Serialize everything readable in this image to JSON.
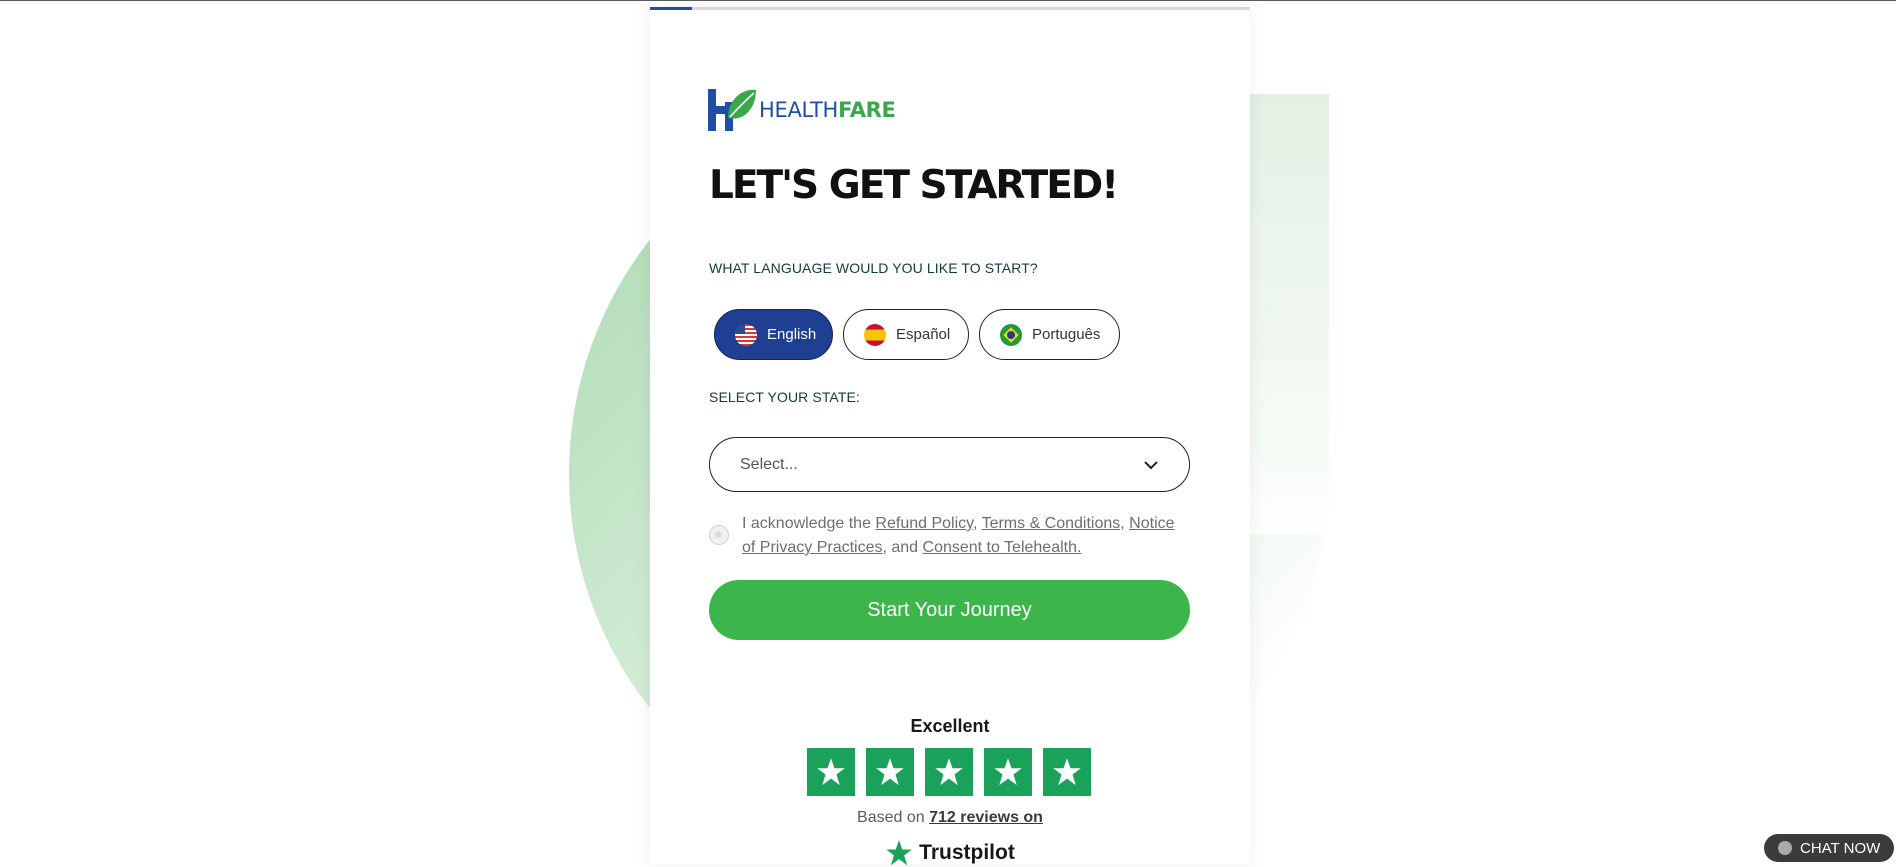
{
  "progress": {
    "percent": 7,
    "accent": "#1f4ea6"
  },
  "logo": {
    "text_health": "HEALTH",
    "text_fare": "FARE"
  },
  "title": "LET'S GET STARTED!",
  "language_section": {
    "label": "WHAT LANGUAGE WOULD YOU LIKE TO START?",
    "options": [
      {
        "label": "English",
        "flag": "us-flag-icon",
        "selected": true
      },
      {
        "label": "Español",
        "flag": "spain-flag-icon",
        "selected": false
      },
      {
        "label": "Português",
        "flag": "brazil-flag-icon",
        "selected": false
      }
    ]
  },
  "state_section": {
    "label": "SELECT YOUR STATE:",
    "value": "Select...",
    "icon": "chevron-down-icon"
  },
  "acknowledgement": {
    "prefix": "I acknowledge the ",
    "refund_policy": "Refund Policy",
    "sep1": ", ",
    "terms": "Terms & Conditions",
    "sep2": ", ",
    "privacy": "Notice of Privacy Practices",
    "sep3": ", and ",
    "telehealth": "Consent to Telehealth."
  },
  "start_button": "Start Your Journey",
  "trustpilot": {
    "rating_label": "Excellent",
    "stars": 5,
    "based_prefix": "Based on ",
    "reviews_link": "712 reviews on",
    "brand": "Trustpilot",
    "star_color": "#1aa25a"
  },
  "chat": {
    "label": "CHAT NOW"
  },
  "colors": {
    "primary_green": "#3cb54a",
    "primary_blue": "#1f3f93"
  }
}
